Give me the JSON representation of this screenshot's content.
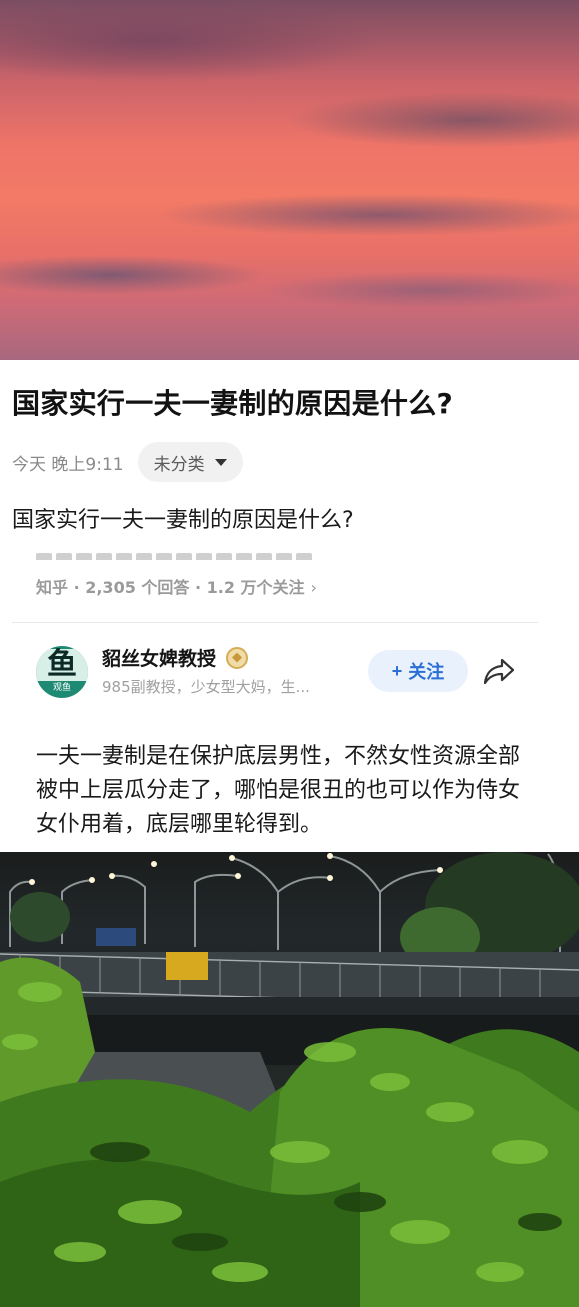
{
  "question": {
    "title": "国家实行一夫一妻制的原因是什么?",
    "time": "今天 晚上9:11",
    "category": "未分类",
    "text": "国家实行一夫一妻制的原因是什么?"
  },
  "source": {
    "text": "知乎 · 2,305 个回答 · 1.2 万个关注",
    "chevron": "›"
  },
  "author": {
    "avatar_big": "鱼",
    "avatar_small": "观鱼",
    "name": "貂丝女婢教授",
    "description": "985副教授，少女型大妈，生...",
    "follow_label": "关注",
    "follow_plus": "+"
  },
  "answer": {
    "text": "一夫一妻制是在保护底层男性，不然女性资源全部被中上层瓜分走了，哪怕是很丑的也可以作为侍女女仆用着，底层哪里轮得到。"
  },
  "icons": {
    "category_dropdown": "caret-down-icon",
    "source_link": "chevron-right-icon",
    "badge": "certified-badge-icon",
    "share": "share-icon"
  },
  "colors": {
    "accent": "#2a6fd6",
    "follow_bg": "#e9f1fd",
    "meta_gray": "#8a8a8a"
  }
}
